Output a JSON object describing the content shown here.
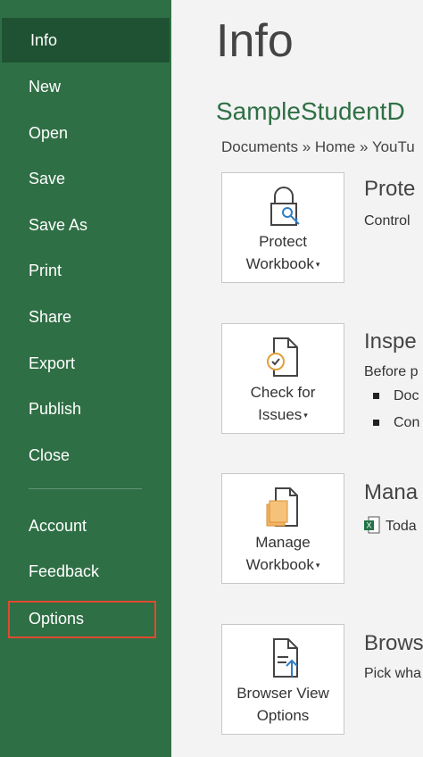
{
  "sidebar": {
    "items": [
      {
        "label": "Info"
      },
      {
        "label": "New"
      },
      {
        "label": "Open"
      },
      {
        "label": "Save"
      },
      {
        "label": "Save As"
      },
      {
        "label": "Print"
      },
      {
        "label": "Share"
      },
      {
        "label": "Export"
      },
      {
        "label": "Publish"
      },
      {
        "label": "Close"
      },
      {
        "label": "Account"
      },
      {
        "label": "Feedback"
      },
      {
        "label": "Options"
      }
    ]
  },
  "main": {
    "title": "Info",
    "file_name": "SampleStudentD",
    "breadcrumb": "Documents » Home » YouTu",
    "sections": [
      {
        "tile_line1": "Protect",
        "tile_line2": "Workbook",
        "title": "Prote",
        "desc": "Control"
      },
      {
        "tile_line1": "Check for",
        "tile_line2": "Issues",
        "title": "Inspe",
        "desc": "Before p",
        "bullets": [
          "Doc",
          "Con"
        ]
      },
      {
        "tile_line1": "Manage",
        "tile_line2": "Workbook",
        "title": "Mana",
        "desc": "Toda"
      },
      {
        "tile_line1": "Browser View",
        "tile_line2": "Options",
        "title": "Brows",
        "desc": "Pick wha"
      }
    ]
  },
  "colors": {
    "sidebar_bg": "#2f6f45",
    "sidebar_active": "#1f5232",
    "accent_green": "#2f6f45",
    "highlight_border": "#e04a2f"
  }
}
